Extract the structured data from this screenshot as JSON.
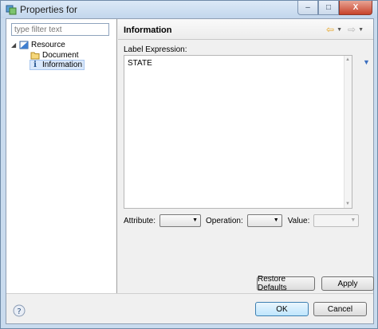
{
  "window": {
    "title": "Properties for",
    "close_glyph": "X",
    "min_glyph": "–",
    "max_glyph": "□"
  },
  "filter": {
    "placeholder": "type filter text"
  },
  "tree": {
    "root": {
      "label": "Resource",
      "icon": "resource-icon"
    },
    "children": [
      {
        "label": "Document",
        "icon": "folder-icon"
      },
      {
        "label": "Information",
        "icon": "info-icon",
        "selected": true
      }
    ]
  },
  "page": {
    "title": "Information",
    "label_expression_label": "Label Expression:",
    "label_expression_value": "STATE",
    "attribute_label": "Attribute:",
    "attribute_value": "",
    "operation_label": "Operation:",
    "operation_value": "",
    "value_label": "Value:",
    "value_value": "",
    "restore_defaults_label": "Restore Defaults",
    "apply_label": "Apply"
  },
  "dialog": {
    "ok_label": "OK",
    "cancel_label": "Cancel"
  },
  "colors": {
    "accent": "#3c7fb1",
    "selection": "#d9e8fb",
    "nav_back": "#e6a21d"
  }
}
